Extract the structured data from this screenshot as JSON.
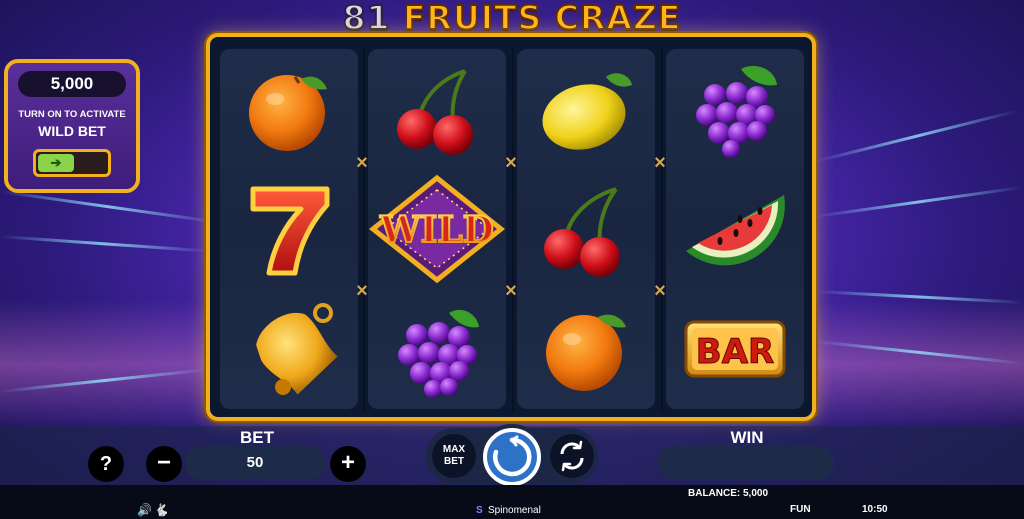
{
  "game": {
    "title_number": "81",
    "title_name": "FRUITS CRAZE"
  },
  "wild_bet": {
    "amount": "5,000",
    "line1": "TURN ON TO ACTIVATE",
    "line2": "WILD BET",
    "toggle_icon": "arrow-right-icon",
    "toggle_state": "off"
  },
  "reels": [
    [
      "orange",
      "seven",
      "bell"
    ],
    [
      "cherries",
      "wild",
      "grapes"
    ],
    [
      "lemon",
      "cherries",
      "orange"
    ],
    [
      "grapes",
      "watermelon",
      "bar"
    ]
  ],
  "symbols": {
    "wild_text": "WILD",
    "bar_text": "BAR",
    "seven_text": "7"
  },
  "controls": {
    "help_label": "?",
    "minus_label": "−",
    "plus_label": "+",
    "bet_label": "BET",
    "bet_value": "50",
    "max_bet_line1": "MAX",
    "max_bet_line2": "BET",
    "win_label": "WIN",
    "win_value": ""
  },
  "status": {
    "balance": "BALANCE: 5,000",
    "provider": "Spinomenal",
    "mode": "FUN",
    "time": "10:50"
  },
  "colors": {
    "gold": "#f2b01f",
    "panel": "#1d2a48",
    "toggle_green": "#8bd44a"
  }
}
